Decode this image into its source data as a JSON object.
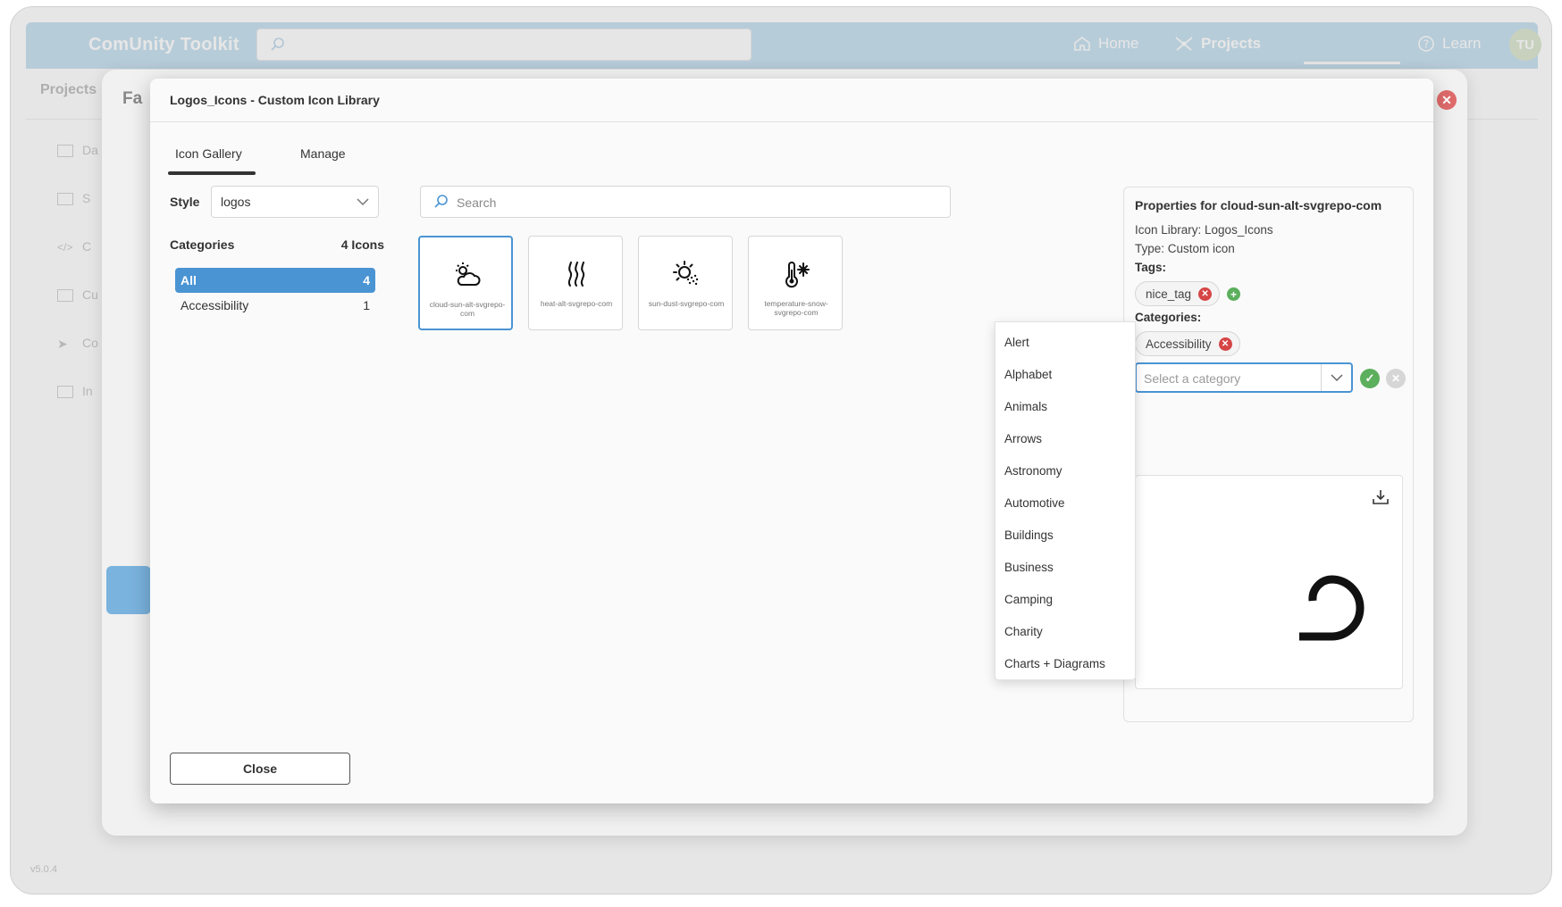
{
  "app": {
    "title": "ComUnity Toolkit",
    "version": "v5.0.4",
    "avatar_initials": "TU"
  },
  "nav": {
    "home": "Home",
    "projects": "Projects",
    "learn": "Learn"
  },
  "background": {
    "projects_label": "Projects",
    "page_title": "Fa",
    "sidebar_items": [
      "Da",
      "S",
      "C",
      "Cu",
      "Co",
      "In"
    ]
  },
  "modal": {
    "title": "Logos_Icons - Custom Icon Library",
    "tabs": [
      {
        "label": "Icon Gallery",
        "active": true
      },
      {
        "label": "Manage",
        "active": false
      }
    ],
    "style_label": "Style",
    "style_value": "logos",
    "categories_label": "Categories",
    "icons_count_label": "4 Icons",
    "categories": [
      {
        "name": "All",
        "count": "4",
        "selected": true
      },
      {
        "name": "Accessibility",
        "count": "1",
        "selected": false
      }
    ],
    "search_placeholder": "Search",
    "icons": [
      {
        "name": "cloud-sun-alt-svgrepo-com",
        "icon": "cloud-sun-icon",
        "selected": true
      },
      {
        "name": "heat-alt-svgrepo-com",
        "icon": "heat-icon",
        "selected": false
      },
      {
        "name": "sun-dust-svgrepo-com",
        "icon": "sun-dust-icon",
        "selected": false
      },
      {
        "name": "temperature-snow-svgrepo-com",
        "icon": "temperature-snow-icon",
        "selected": false
      }
    ],
    "close_label": "Close"
  },
  "properties": {
    "title": "Properties for cloud-sun-alt-svgrepo-com",
    "library": "Icon Library: Logos_Icons",
    "type": "Type: Custom icon",
    "tags_label": "Tags:",
    "tags": [
      "nice_tag"
    ],
    "categories_label": "Categories:",
    "categories": [
      "Accessibility"
    ],
    "category_select_placeholder": "Select a category",
    "dropdown_options": [
      "Alert",
      "Alphabet",
      "Animals",
      "Arrows",
      "Astronomy",
      "Automotive",
      "Buildings",
      "Business",
      "Camping",
      "Charity",
      "Charts + Diagrams"
    ]
  },
  "colors": {
    "topbar": "#a9cfe8",
    "accent": "#4a94d4",
    "danger": "#d64545",
    "success": "#5caf5c"
  }
}
